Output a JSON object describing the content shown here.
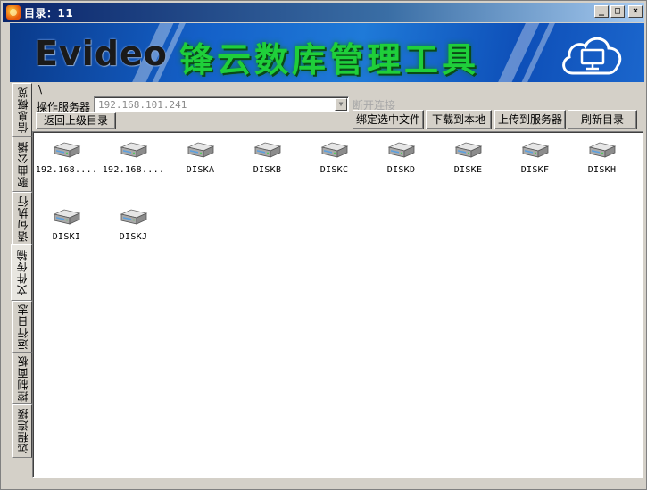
{
  "window": {
    "title": "目录：11",
    "minimize": "_",
    "maximize": "□",
    "close": "×"
  },
  "banner": {
    "logo": "Evideo",
    "title": "锋云数库管理工具"
  },
  "tabs": [
    {
      "label": "信息概览"
    },
    {
      "label": "歌曲公播"
    },
    {
      "label": "语句执行"
    },
    {
      "label": "文件传输"
    },
    {
      "label": "运行日志"
    },
    {
      "label": "控制面板"
    },
    {
      "label": "远程连接"
    }
  ],
  "toolbar": {
    "path": "\\",
    "server_label": "操作服务器",
    "server_value": "192.168.101.241",
    "disconnect_label": "断开连接",
    "up_dir_label": "返回上级目录",
    "bind_label": "绑定选中文件",
    "download_label": "下载到本地",
    "upload_label": "上传到服务器",
    "refresh_label": "刷新目录"
  },
  "files": [
    {
      "label": "192.168...."
    },
    {
      "label": "192.168...."
    },
    {
      "label": "DISKA"
    },
    {
      "label": "DISKB"
    },
    {
      "label": "DISKC"
    },
    {
      "label": "DISKD"
    },
    {
      "label": "DISKE"
    },
    {
      "label": "DISKF"
    },
    {
      "label": "DISKH"
    },
    {
      "label": "DISKI"
    },
    {
      "label": "DISKJ"
    }
  ],
  "colors": {
    "banner_title": "#1fcf3a",
    "titlebar": "#0a246a",
    "face": "#d4d0c8"
  }
}
